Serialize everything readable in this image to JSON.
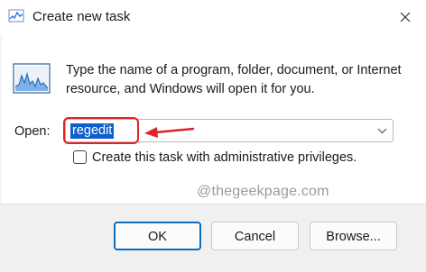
{
  "window": {
    "title": "Create new task"
  },
  "description": "Type the name of a program, folder, document, or Internet resource, and Windows will open it for you.",
  "open": {
    "label": "Open:",
    "value": "regedit"
  },
  "admin_option": {
    "label": "Create this task with administrative privileges.",
    "checked": false
  },
  "watermark": "@thegeekpage.com",
  "buttons": {
    "ok": "OK",
    "cancel": "Cancel",
    "browse": "Browse..."
  },
  "icons": {
    "title": "task-manager-icon",
    "app": "performance-chart-icon",
    "close": "close-icon",
    "dropdown": "chevron-down-icon"
  },
  "colors": {
    "selection": "#0f5fcc",
    "annotation": "#e0232a",
    "accent": "#0f6cbd"
  }
}
